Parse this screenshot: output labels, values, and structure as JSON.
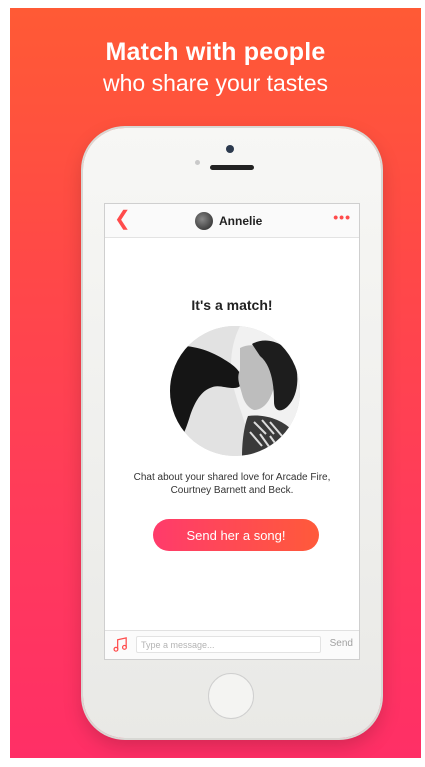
{
  "promo": {
    "headline": "Match with people",
    "subline": "who share your tastes"
  },
  "nav": {
    "back_icon": "chevron-left",
    "username": "Annelie",
    "more_icon": "more-horizontal"
  },
  "match": {
    "title": "It's a match!",
    "caption": "Chat about your shared love for Arcade Fire, Courtney Barnett and Beck.",
    "button_label": "Send her a song!"
  },
  "composer": {
    "placeholder": "Type a message...",
    "send_label": "Send",
    "music_icon": "music-note"
  },
  "colors": {
    "accent": "#ff4b4b",
    "gradient_top": "#ff5a35",
    "gradient_bottom": "#ff2f66"
  }
}
